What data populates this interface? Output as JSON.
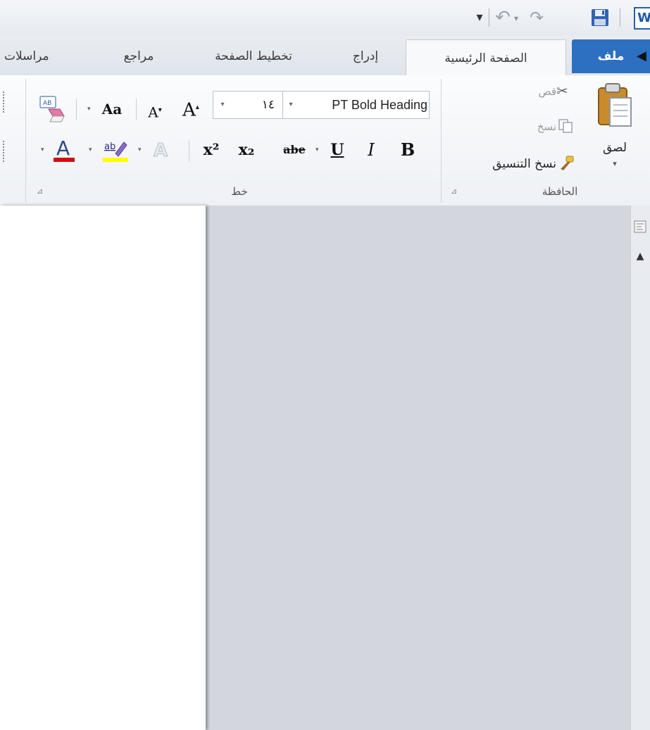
{
  "app": {
    "logo_letter": "W"
  },
  "qat": {
    "customize_glyph": "▾",
    "undo_glyph": "↶",
    "redo_glyph": "↷"
  },
  "tabs": [
    {
      "label": "ملف",
      "active": false,
      "accent": "#2d6fc0"
    },
    {
      "label": "الصفحة الرئيسية",
      "active": true
    },
    {
      "label": "إدراج"
    },
    {
      "label": "تخطيط الصفحة"
    },
    {
      "label": "مراجع"
    },
    {
      "label": "مراسلات"
    }
  ],
  "clipboard": {
    "paste_label": "لصق",
    "cut_label": "قص",
    "copy_label": "نسخ",
    "format_painter_label": "نسخ التنسيق",
    "group_label": "الحافظة"
  },
  "font": {
    "font_name": "PT Bold Heading",
    "font_size": "١٤",
    "group_label": "خط",
    "bold": "B",
    "italic": "I",
    "underline": "U",
    "strike": "abe",
    "subscript": "x₂",
    "superscript": "x²",
    "grow": "A",
    "shrink": "A",
    "change_case": "Aa",
    "font_color": "#d01010",
    "highlight_color": "#ffff00"
  },
  "icons": {
    "dropdown": "▾",
    "launcher": "⊿",
    "scroll_up": "▲"
  }
}
